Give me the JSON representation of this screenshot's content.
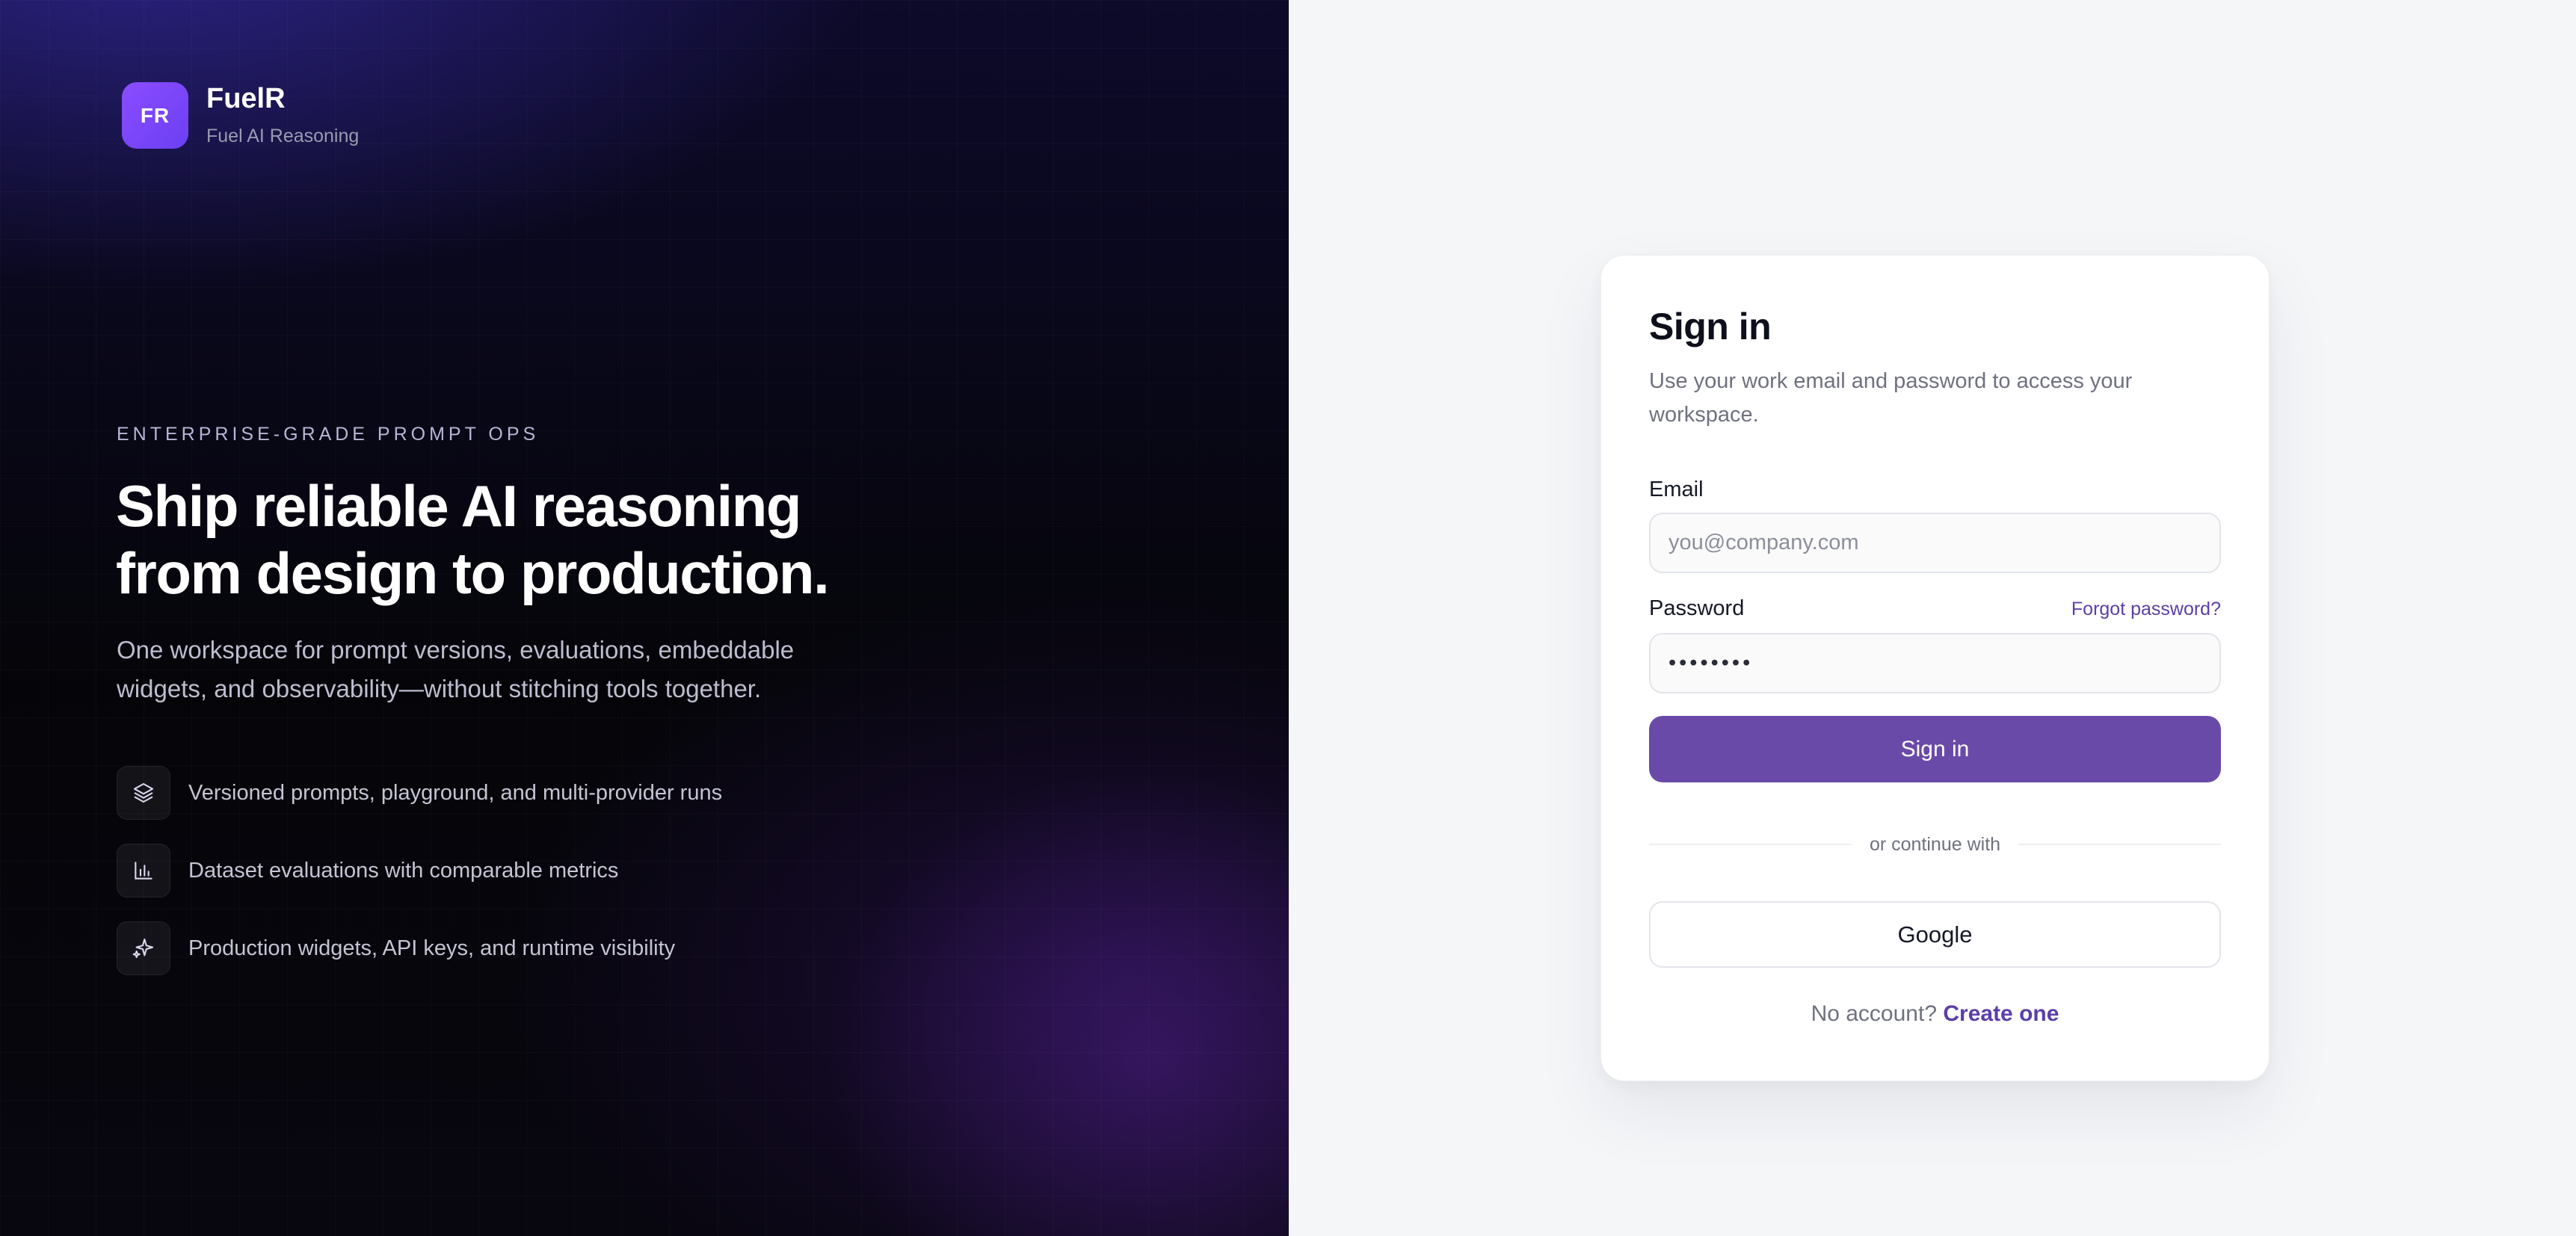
{
  "brand": {
    "logo_initials": "FR",
    "name": "FuelR",
    "tagline": "Fuel AI Reasoning"
  },
  "hero": {
    "eyebrow": "ENTERPRISE-GRADE PROMPT OPS",
    "headline_line1": "Ship reliable AI reasoning",
    "headline_line2": "from design to production.",
    "lede_line1": "One workspace for prompt versions, evaluations, embeddable",
    "lede_line2": "widgets, and observability—without stitching tools together.",
    "features": [
      {
        "icon": "layers-icon",
        "text": "Versioned prompts, playground, and multi-provider runs"
      },
      {
        "icon": "bar-chart-icon",
        "text": "Dataset evaluations with comparable metrics"
      },
      {
        "icon": "sparkles-icon",
        "text": "Production widgets, API keys, and runtime visibility"
      }
    ]
  },
  "signin": {
    "title": "Sign in",
    "subtitle": "Use your work email and password to access your workspace.",
    "email_label": "Email",
    "email_placeholder": "you@company.com",
    "password_label": "Password",
    "forgot_label": "Forgot password?",
    "password_value": "••••••••",
    "submit_label": "Sign in",
    "divider_text": "or continue with",
    "google_label": "Google",
    "no_account_text": "No account?",
    "create_label": "Create one"
  },
  "colors": {
    "accent": "#6a4aa8",
    "link": "#5b3fa8",
    "logo": "#7b45f8",
    "hero_bg": "#050509",
    "page_bg": "#f5f6f8"
  }
}
